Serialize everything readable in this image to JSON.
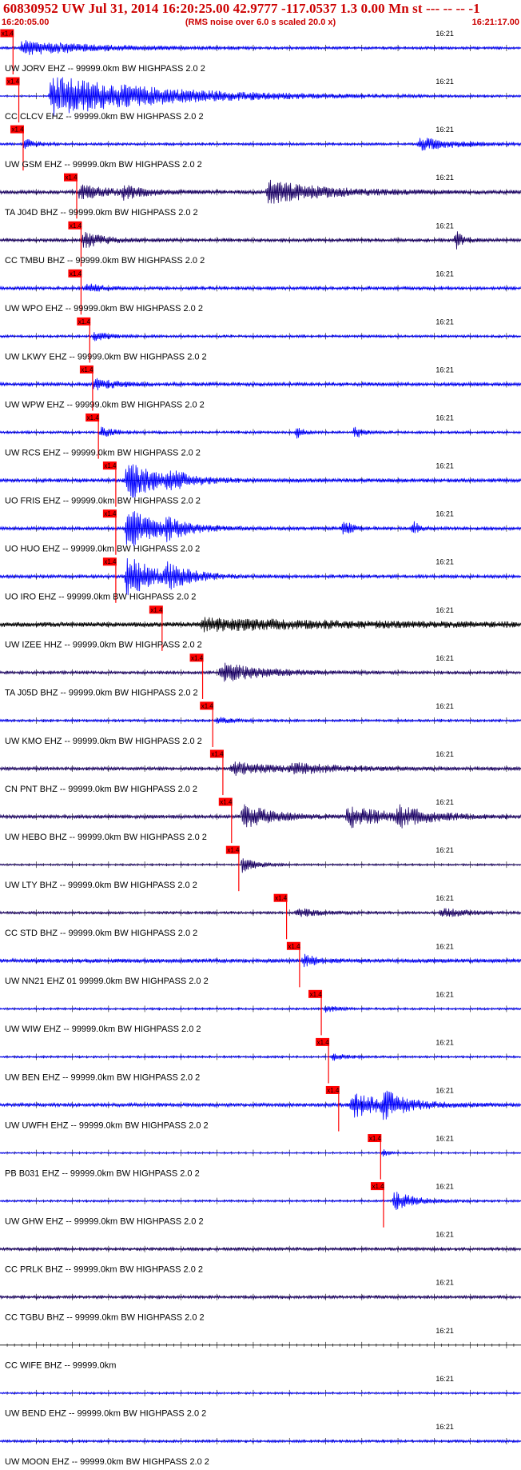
{
  "header": {
    "title": "60830952 UW Jul 31, 2014 16:20:25.00   42.9777 -117.0537  1.3 0.00 Mn st --- -- --   -1",
    "start_time": "16:20:05.00",
    "rms_note": "(RMS noise over 6.0 s scaled 20.0 x)",
    "end_time": "16:21:17.00"
  },
  "colors": {
    "header_text": "#cc0000",
    "pick": "#ff0000",
    "trace_blue": "#0000ff",
    "trace_navy": "#1a0066",
    "trace_black": "#000000",
    "axis": "#000000"
  },
  "chart_data": {
    "type": "seismogram",
    "time_axis": {
      "start": "16:20:05.00",
      "end": "16:21:17.00",
      "tick_label": "16:21",
      "tick_label_time_s": 60
    },
    "pick_label": "x1.4",
    "traces": [
      {
        "label": "UW JORV EHZ -- 99999.0km BW  HIGHPASS  2.0  2",
        "pick_s": 1.8,
        "color": "blue",
        "noise": 1.5,
        "events": [
          [
            3,
            10,
            9
          ]
        ]
      },
      {
        "label": "CC CLCV EHZ -- 99999.0km BW  HIGHPASS  2.0  2",
        "pick_s": 2.6,
        "color": "blue",
        "noise": 0.8,
        "events": [
          [
            7,
            16,
            26
          ]
        ]
      },
      {
        "label": "UW GSM EHZ -- 99999.0km BW  HIGHPASS  2.0  2",
        "pick_s": 3.2,
        "color": "blue",
        "noise": 1.5,
        "events": [
          [
            3.4,
            1.5,
            7
          ],
          [
            58,
            5,
            8
          ]
        ]
      },
      {
        "label": "TA J04D BHZ -- 99999.0km BW  HIGHPASS  2.0  2",
        "pick_s": 10.6,
        "color": "navy",
        "noise": 2.2,
        "events": [
          [
            11,
            4,
            9
          ],
          [
            17,
            3,
            7
          ],
          [
            37,
            8,
            14
          ]
        ]
      },
      {
        "label": "CC TMBU BHZ -- 99999.0km BW  HIGHPASS  2.0  2",
        "pick_s": 11.2,
        "color": "navy",
        "noise": 2.0,
        "events": [
          [
            11.5,
            3,
            10
          ],
          [
            63,
            1,
            12
          ]
        ]
      },
      {
        "label": "UW WPO EHZ -- 99999.0km BW  HIGHPASS  2.0  2",
        "pick_s": 11.2,
        "color": "blue",
        "noise": 2.0,
        "events": [
          [
            12,
            2,
            6
          ]
        ]
      },
      {
        "label": "UW LKWY EHZ -- 99999.0km BW  HIGHPASS  2.0  2",
        "pick_s": 12.4,
        "color": "blue",
        "noise": 1.5,
        "events": [
          [
            13,
            2,
            6
          ]
        ]
      },
      {
        "label": "UW WPW EHZ -- 99999.0km BW  HIGHPASS  2.0  2",
        "pick_s": 12.8,
        "color": "blue",
        "noise": 2.2,
        "events": [
          [
            13,
            3,
            7
          ]
        ]
      },
      {
        "label": "UW RCS EHZ -- 99999.0km BW  HIGHPASS  2.0  2",
        "pick_s": 13.6,
        "color": "blue",
        "noise": 1.5,
        "events": [
          [
            14,
            2,
            6
          ],
          [
            41,
            1,
            7
          ],
          [
            49,
            1,
            9
          ]
        ]
      },
      {
        "label": "UO FRIS EHZ -- 99999.0km BW  HIGHPASS  2.0  2",
        "pick_s": 16.0,
        "color": "blue",
        "noise": 2.5,
        "events": [
          [
            17.5,
            4,
            26
          ],
          [
            23,
            3,
            9
          ]
        ]
      },
      {
        "label": "UO HUO EHZ -- 99999.0km BW  HIGHPASS  2.0  2",
        "pick_s": 16.0,
        "color": "blue",
        "noise": 2.0,
        "events": [
          [
            17.5,
            4,
            26
          ],
          [
            23,
            3,
            9
          ],
          [
            47.5,
            1,
            12
          ],
          [
            57,
            1,
            9
          ]
        ]
      },
      {
        "label": "UO IRO EHZ -- 99999.0km BW  HIGHPASS  2.0  2",
        "pick_s": 16.0,
        "color": "blue",
        "noise": 2.0,
        "events": [
          [
            17.5,
            4,
            26
          ],
          [
            23,
            3,
            12
          ]
        ]
      },
      {
        "label": "UW IZEE HHZ -- 99999.0km BW  HIGHPASS  2.0  2",
        "pick_s": 22.4,
        "color": "black",
        "noise": 3.0,
        "events": [
          [
            28,
            20,
            7
          ]
        ]
      },
      {
        "label": "TA J05D BHZ -- 99999.0km BW  HIGHPASS  2.0  2",
        "pick_s": 28.0,
        "color": "navy",
        "noise": 1.8,
        "events": [
          [
            30.5,
            6,
            12
          ]
        ]
      },
      {
        "label": "UW KMO EHZ -- 99999.0km BW  HIGHPASS  2.0  2",
        "pick_s": 29.4,
        "color": "blue",
        "noise": 1.5,
        "events": [
          [
            30,
            2,
            4
          ]
        ]
      },
      {
        "label": "CN PNT BHZ -- 99999.0km BW  HIGHPASS  2.0  2",
        "pick_s": 30.8,
        "color": "navy",
        "noise": 2.0,
        "events": [
          [
            32,
            6,
            8
          ],
          [
            40,
            8,
            5
          ]
        ]
      },
      {
        "label": "UW HEBO BHZ -- 99999.0km BW  HIGHPASS  2.0  2",
        "pick_s": 32.0,
        "color": "navy",
        "noise": 2.2,
        "events": [
          [
            33.5,
            4,
            16
          ],
          [
            48,
            6,
            13
          ],
          [
            55,
            4,
            10
          ]
        ]
      },
      {
        "label": "UW LTY BHZ -- 99999.0km BW  HIGHPASS  2.0  2",
        "pick_s": 33.0,
        "color": "navy",
        "noise": 1.0,
        "events": [
          [
            33.5,
            2,
            10
          ]
        ]
      },
      {
        "label": "CC STD BHZ -- 99999.0km BW  HIGHPASS  2.0  2",
        "pick_s": 39.6,
        "color": "navy",
        "noise": 1.5,
        "events": [
          [
            41,
            3,
            6
          ],
          [
            61,
            3,
            7
          ]
        ]
      },
      {
        "label": "UW NN21 EHZ 01 99999.0km BW  HIGHPASS  2.0  2",
        "pick_s": 41.4,
        "color": "blue",
        "noise": 2.5,
        "events": [
          [
            42,
            2,
            7
          ]
        ]
      },
      {
        "label": "UW WIW EHZ -- 99999.0km BW  HIGHPASS  2.0  2",
        "pick_s": 44.4,
        "color": "blue",
        "noise": 1.2,
        "events": [
          [
            45,
            2,
            4
          ]
        ]
      },
      {
        "label": "UW BEN EHZ -- 99999.0km BW  HIGHPASS  2.0  2",
        "pick_s": 45.4,
        "color": "blue",
        "noise": 1.2,
        "events": [
          [
            46,
            2,
            4
          ]
        ]
      },
      {
        "label": "UW UWFH EHZ -- 99999.0km BW  HIGHPASS  2.0  2",
        "pick_s": 46.8,
        "color": "blue",
        "noise": 2.2,
        "events": [
          [
            48.5,
            5,
            16
          ],
          [
            53,
            3,
            12
          ]
        ]
      },
      {
        "label": "PB B031 EHZ -- 99999.0km BW  HIGHPASS  2.0  2",
        "pick_s": 52.6,
        "color": "blue",
        "noise": 0.8,
        "events": [
          [
            53,
            1,
            5
          ]
        ]
      },
      {
        "label": "UW GHW EHZ -- 99999.0km BW  HIGHPASS  2.0  2",
        "pick_s": 53.0,
        "color": "blue",
        "noise": 1.2,
        "events": [
          [
            54.5,
            3,
            12
          ]
        ]
      },
      {
        "label": "CC PRLK BHZ -- 99999.0km BW  HIGHPASS  2.0  2",
        "pick_s": null,
        "color": "navy",
        "noise": 1.8,
        "events": []
      },
      {
        "label": "CC TGBU BHZ -- 99999.0km BW  HIGHPASS  2.0  2",
        "pick_s": null,
        "color": "navy",
        "noise": 1.8,
        "events": []
      },
      {
        "label": "CC WIFE BHZ -- 99999.0km",
        "pick_s": null,
        "color": "none",
        "noise": 0,
        "events": []
      },
      {
        "label": "UW BEND EHZ -- 99999.0km BW  HIGHPASS  2.0  2",
        "pick_s": null,
        "color": "blue",
        "noise": 1.0,
        "events": []
      },
      {
        "label": "UW MOON EHZ -- 99999.0km BW  HIGHPASS  2.0  2",
        "pick_s": null,
        "color": "blue",
        "noise": 1.5,
        "events": []
      }
    ]
  }
}
